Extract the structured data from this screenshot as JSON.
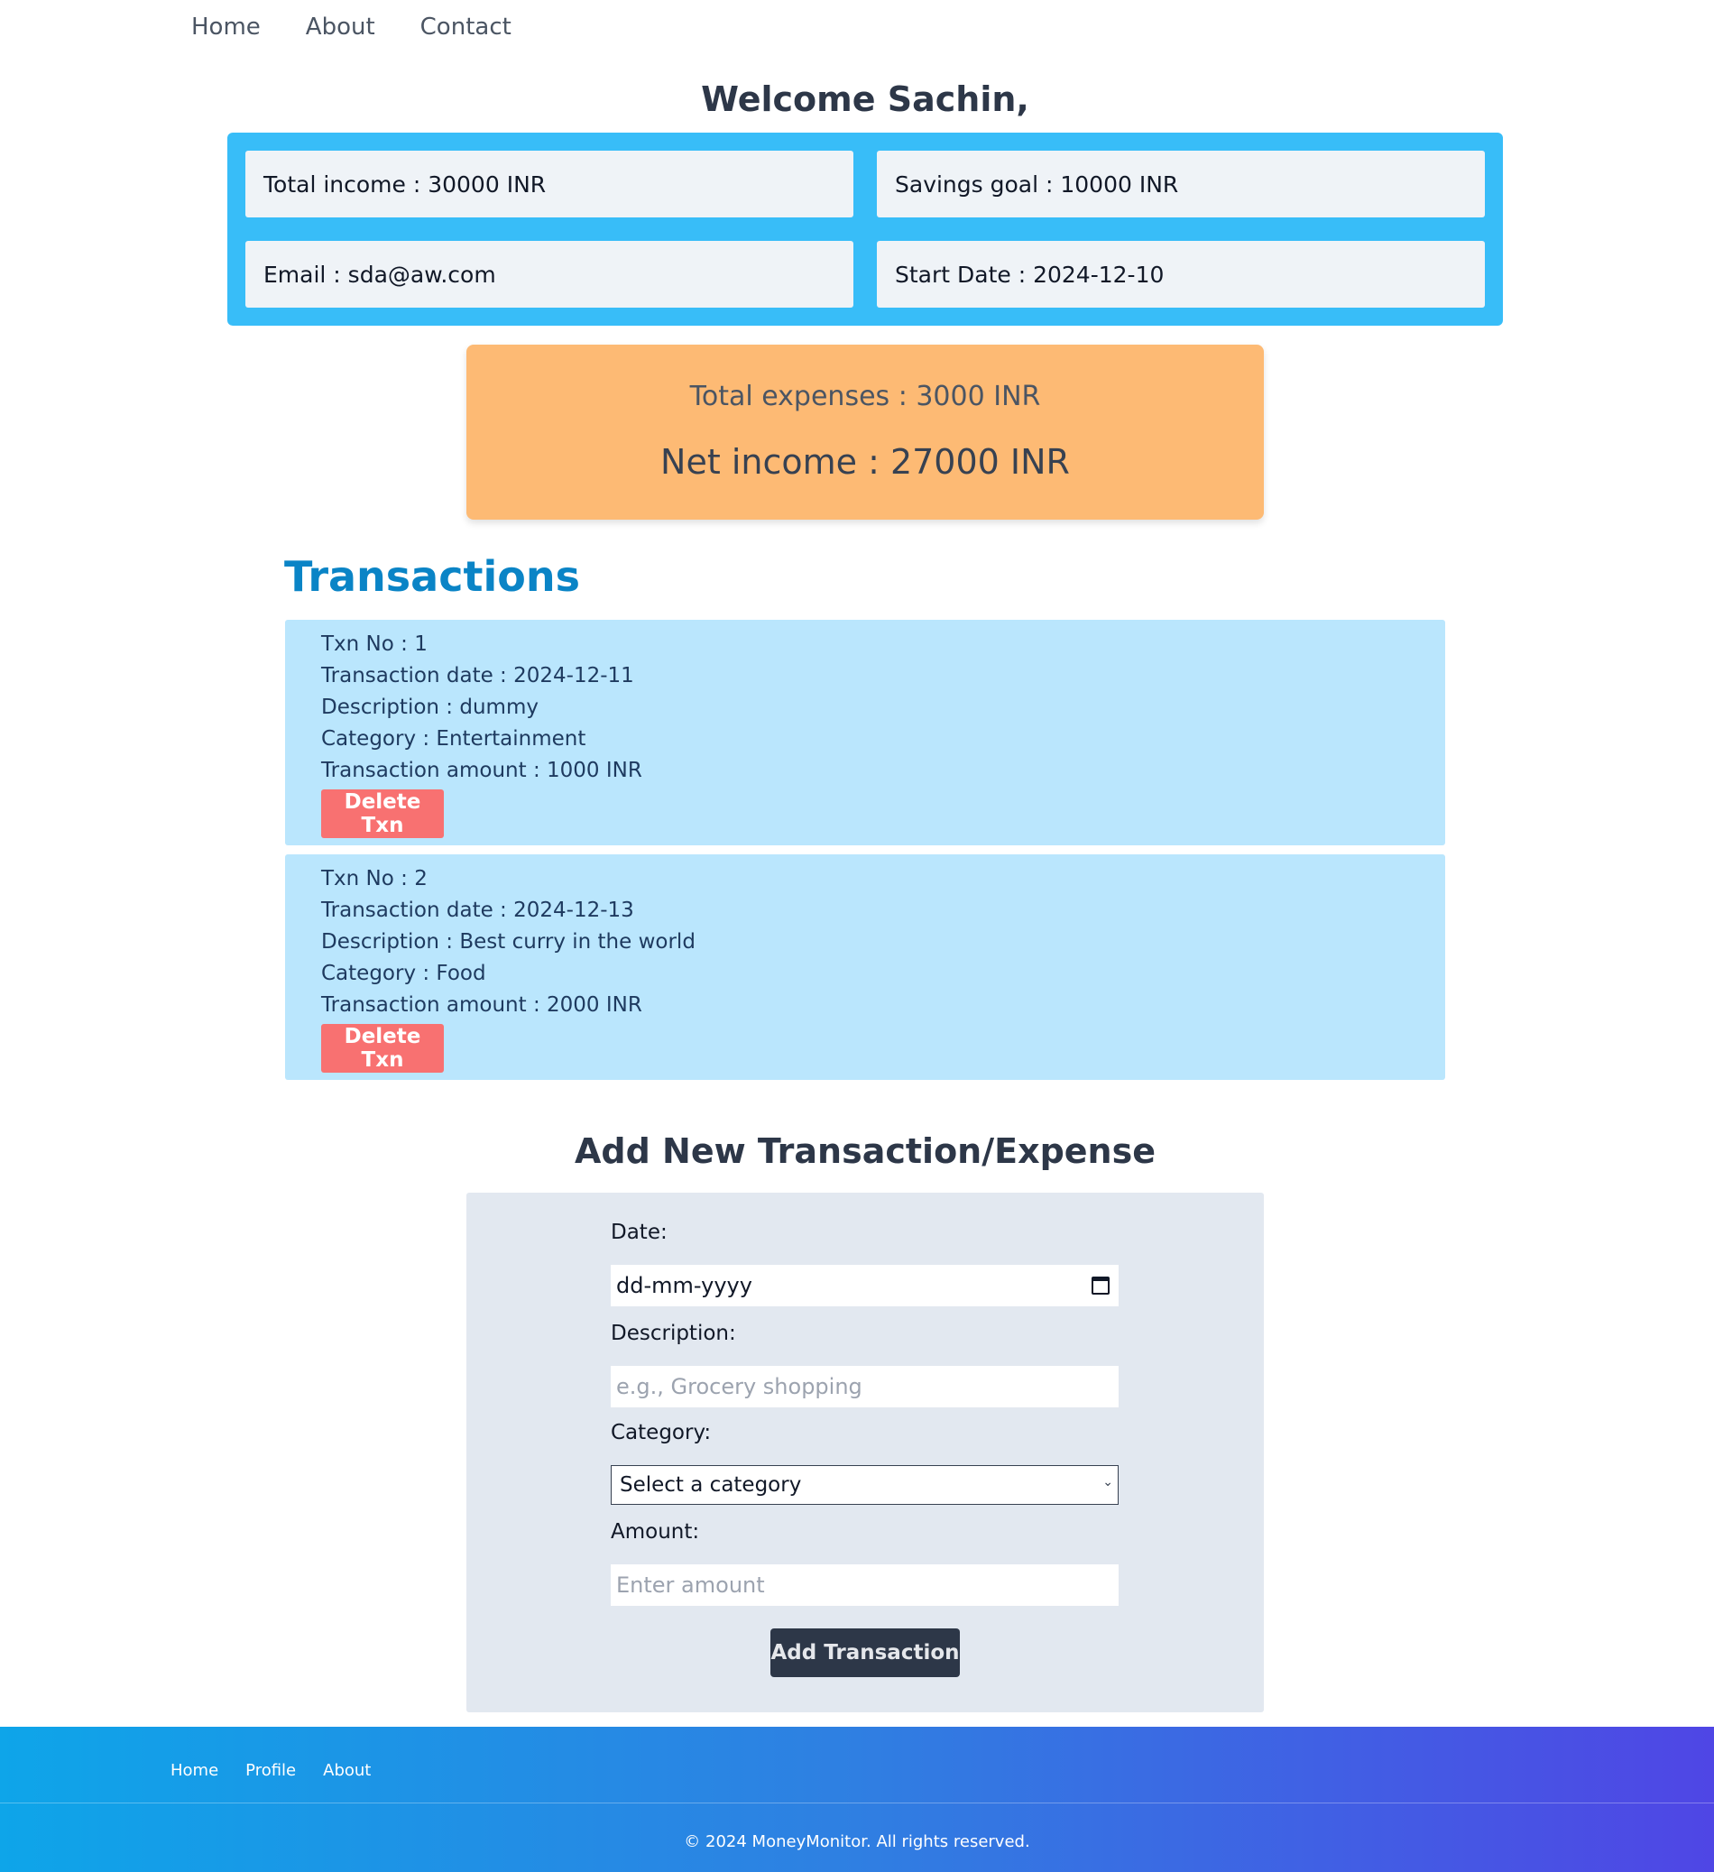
{
  "nav": {
    "items": [
      {
        "label": "Home"
      },
      {
        "label": "About"
      },
      {
        "label": "Contact"
      }
    ]
  },
  "welcome": "Welcome Sachin,",
  "info": {
    "total_income": "Total income : 30000 INR",
    "savings_goal": "Savings goal : 10000 INR",
    "email": "Email : sda@aw.com",
    "start_date": "Start Date : 2024-12-10"
  },
  "summary": {
    "total_expenses": "Total expenses : 3000 INR",
    "net_income": "Net income : 27000 INR"
  },
  "transactions": {
    "heading": "Transactions",
    "items": [
      {
        "txn_no": "Txn No : 1",
        "date": "Transaction date : 2024-12-11",
        "description": "Description : dummy",
        "category": "Category : Entertainment",
        "amount": "Transaction amount : 1000 INR",
        "delete_label": "Delete Txn"
      },
      {
        "txn_no": "Txn No : 2",
        "date": "Transaction date : 2024-12-13",
        "description": "Description : Best curry in the world",
        "category": "Category : Food",
        "amount": "Transaction amount : 2000 INR",
        "delete_label": "Delete Txn"
      }
    ]
  },
  "add_form": {
    "heading": "Add New Transaction/Expense",
    "date_label": "Date:",
    "date_placeholder": "dd-mm-yyyy",
    "description_label": "Description:",
    "description_placeholder": "e.g., Grocery shopping",
    "category_label": "Category:",
    "category_selected": "Select a category",
    "amount_label": "Amount:",
    "amount_placeholder": "Enter amount",
    "submit_label": "Add Transaction"
  },
  "footer": {
    "links": [
      {
        "label": "Home"
      },
      {
        "label": "Profile"
      },
      {
        "label": "About"
      }
    ],
    "copyright": "© 2024 MoneyMonitor. All rights reserved."
  },
  "colors": {
    "info_bg": "#38bdf8",
    "summary_bg": "#fdba74",
    "transaction_bg": "#bae6fd",
    "delete_button": "#f87171",
    "heading_blue": "#0a84c6",
    "submit_button": "#2d3748"
  }
}
